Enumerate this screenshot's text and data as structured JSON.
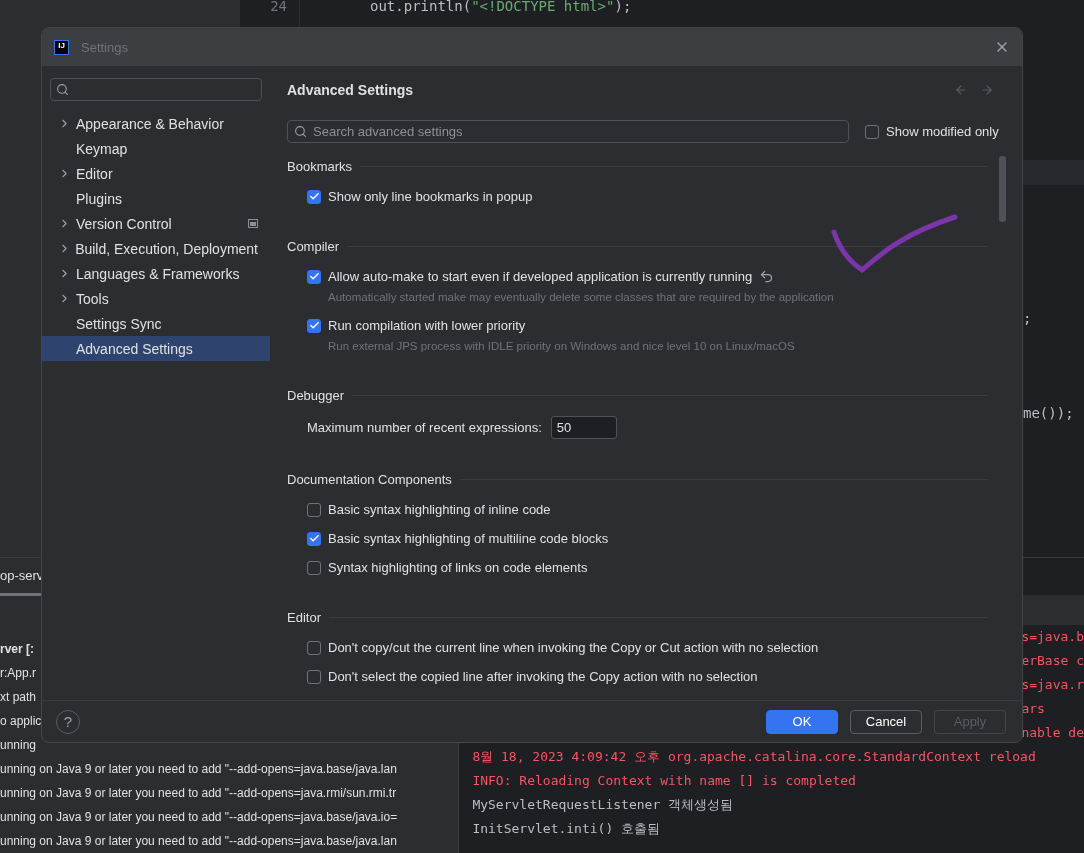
{
  "editor": {
    "lines": [
      {
        "number": "24",
        "tokens": [
          {
            "text": "out.println(",
            "kind": "plain"
          },
          {
            "text": "\"<!DOCTYPE html>\"",
            "kind": "string"
          },
          {
            "text": ");",
            "kind": "plain"
          }
        ]
      }
    ],
    "right_fragments": [
      ";",
      "me());"
    ]
  },
  "run_panel": {
    "tab": "op-serv",
    "rows": [
      {
        "text": "rver [:",
        "bold": true
      },
      {
        "text": "r:App.r",
        "bold": false
      },
      {
        "text": "xt path",
        "bold": false
      },
      {
        "text": "o applic",
        "bold": false
      },
      {
        "text": "unning",
        "bold": false
      },
      {
        "text": "unning on Java 9 or later you need to add \"--add-opens=java.base/java.lan",
        "bold": false
      },
      {
        "text": "unning on Java 9 or later you need to add \"--add-opens=java.rmi/sun.rmi.tr",
        "bold": false
      },
      {
        "text": "unning on Java 9 or later you need to add \"--add-opens=java.base/java.io=",
        "bold": false
      },
      {
        "text": "unning on Java 9 or later you need to add \"--add-opens=java.base/java.lan",
        "bold": false
      }
    ]
  },
  "console": {
    "clipped_lines": [
      "s=java.b",
      "erBase c",
      "s=java.r",
      "ars",
      "nable de"
    ],
    "lines": [
      {
        "text": "8월 18, 2023 4:09:42 오후 org.apache.catalina.core.StandardContext reload",
        "error": true
      },
      {
        "text": "INFO: Reloading Context with name [] is completed",
        "error": true
      },
      {
        "text": "MyServletRequestListener 객체생성됨",
        "error": false
      },
      {
        "text": "InitServlet.inti() 호출됨",
        "error": false
      }
    ]
  },
  "dialog": {
    "logo": "IJ",
    "title": "Settings",
    "sidebar": {
      "items": [
        {
          "label": "Appearance & Behavior",
          "expandable": true,
          "marked": false,
          "selected": false
        },
        {
          "label": "Keymap",
          "expandable": false,
          "marked": false,
          "selected": false
        },
        {
          "label": "Editor",
          "expandable": true,
          "marked": false,
          "selected": false
        },
        {
          "label": "Plugins",
          "expandable": false,
          "marked": false,
          "selected": false
        },
        {
          "label": "Version Control",
          "expandable": true,
          "marked": true,
          "selected": false
        },
        {
          "label": "Build, Execution, Deployment",
          "expandable": true,
          "marked": false,
          "selected": false
        },
        {
          "label": "Languages & Frameworks",
          "expandable": true,
          "marked": false,
          "selected": false
        },
        {
          "label": "Tools",
          "expandable": true,
          "marked": false,
          "selected": false
        },
        {
          "label": "Settings Sync",
          "expandable": false,
          "marked": false,
          "selected": false
        },
        {
          "label": "Advanced Settings",
          "expandable": false,
          "marked": false,
          "selected": true
        }
      ]
    },
    "page_title": "Advanced Settings",
    "search": {
      "placeholder": "Search advanced settings"
    },
    "show_modified_only": {
      "label": "Show modified only",
      "checked": false
    },
    "sections": [
      {
        "title": "Bookmarks",
        "items": [
          {
            "kind": "checkbox",
            "label": "Show only line bookmarks in popup",
            "checked": true,
            "modified": false
          }
        ]
      },
      {
        "title": "Compiler",
        "items": [
          {
            "kind": "checkbox",
            "label": "Allow auto-make to start even if developed application is currently running",
            "checked": true,
            "modified": true,
            "description": "Automatically started make may eventually delete some classes that are required by the application"
          },
          {
            "kind": "checkbox",
            "label": "Run compilation with lower priority",
            "checked": true,
            "modified": false,
            "description": "Run external JPS process with IDLE priority on Windows and nice level 10 on Linux/macOS"
          }
        ]
      },
      {
        "title": "Debugger",
        "items": [
          {
            "kind": "number",
            "label": "Maximum number of recent expressions:",
            "value": "50"
          }
        ]
      },
      {
        "title": "Documentation Components",
        "items": [
          {
            "kind": "checkbox",
            "label": "Basic syntax highlighting of inline code",
            "checked": false,
            "modified": false
          },
          {
            "kind": "checkbox",
            "label": "Basic syntax highlighting of multiline code blocks",
            "checked": true,
            "modified": false
          },
          {
            "kind": "checkbox",
            "label": "Syntax highlighting of links on code elements",
            "checked": false,
            "modified": false
          }
        ]
      },
      {
        "title": "Editor",
        "items": [
          {
            "kind": "checkbox",
            "label": "Don't copy/cut the current line when invoking the Copy or Cut action with no selection",
            "checked": false,
            "modified": false
          },
          {
            "kind": "checkbox",
            "label": "Don't select the copied line after invoking the Copy action with no selection",
            "checked": false,
            "modified": false
          }
        ]
      }
    ],
    "help": "?",
    "buttons": [
      {
        "label": "OK",
        "kind": "primary",
        "disabled": false
      },
      {
        "label": "Cancel",
        "kind": "secondary",
        "disabled": false
      },
      {
        "label": "Apply",
        "kind": "secondary",
        "disabled": true
      }
    ]
  }
}
